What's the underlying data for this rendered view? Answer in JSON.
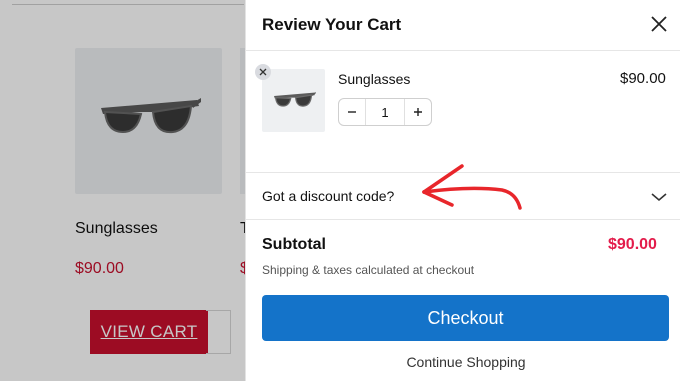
{
  "background_page": {
    "products": [
      {
        "title": "Sunglasses",
        "price": "$90.00"
      },
      {
        "title": "T",
        "price": "$"
      }
    ],
    "view_cart_label": "VIEW CART"
  },
  "cart": {
    "title": "Review Your Cart",
    "items": [
      {
        "name": "Sunglasses",
        "price": "$90.00",
        "quantity": "1"
      }
    ],
    "discount_label": "Got a discount code?",
    "subtotal_label": "Subtotal",
    "subtotal_value": "$90.00",
    "shipping_note": "Shipping & taxes calculated at checkout",
    "checkout_label": "Checkout",
    "continue_label": "Continue Shopping"
  },
  "icons": {
    "close": "close-icon",
    "remove": "remove-item-icon",
    "minus": "minus-icon",
    "plus": "plus-icon",
    "chevron": "chevron-down-icon",
    "product": "sunglasses-icon",
    "annotation": "red-arrow-annotation"
  },
  "colors": {
    "price_red": "#c8102e",
    "subtotal_red": "#e31c4b",
    "checkout_blue": "#1473c9",
    "arrow_red": "#e8262b"
  }
}
